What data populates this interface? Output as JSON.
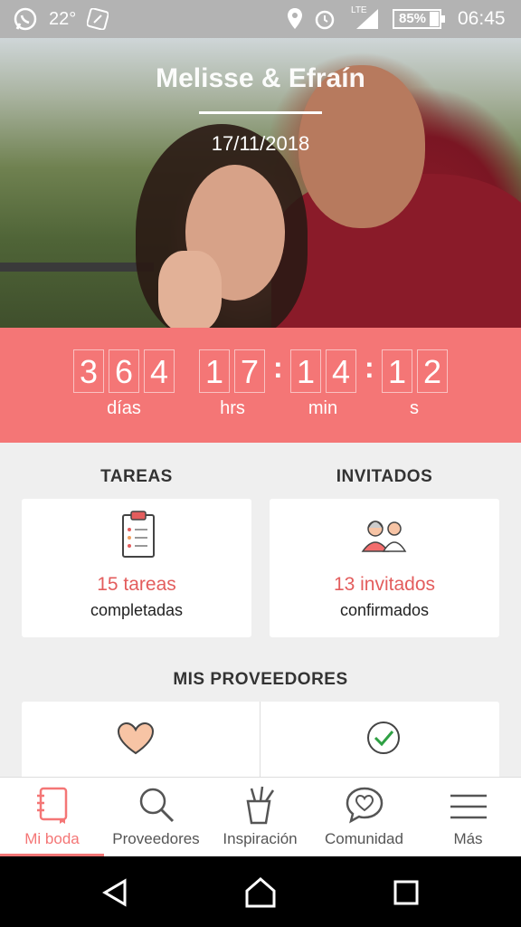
{
  "status_bar": {
    "temperature": "22°",
    "network": "LTE",
    "battery": "85%",
    "time": "06:45"
  },
  "hero": {
    "couple_names": "Melisse & Efraín",
    "date": "17/11/2018"
  },
  "countdown": {
    "days": [
      "3",
      "6",
      "4"
    ],
    "hours": [
      "1",
      "7"
    ],
    "minutes": [
      "1",
      "4"
    ],
    "seconds": [
      "1",
      "2"
    ],
    "labels": {
      "days": "días",
      "hours": "hrs",
      "minutes": "min",
      "seconds": "s"
    }
  },
  "tasks": {
    "title": "TAREAS",
    "count": "15 tareas",
    "subtitle": "completadas"
  },
  "guests": {
    "title": "INVITADOS",
    "count": "13 invitados",
    "subtitle": "confirmados"
  },
  "vendors": {
    "title": "MIS PROVEEDORES"
  },
  "tabs": [
    {
      "label": "Mi boda",
      "icon": "notebook-icon",
      "active": true
    },
    {
      "label": "Proveedores",
      "icon": "search-icon",
      "active": false
    },
    {
      "label": "Inspiración",
      "icon": "pencil-cup-icon",
      "active": false
    },
    {
      "label": "Comunidad",
      "icon": "heart-chat-icon",
      "active": false
    },
    {
      "label": "Más",
      "icon": "menu-icon",
      "active": false
    }
  ],
  "colors": {
    "accent": "#f47676",
    "accent_text": "#e35d5d",
    "status_bar": "#b3b3b3"
  }
}
